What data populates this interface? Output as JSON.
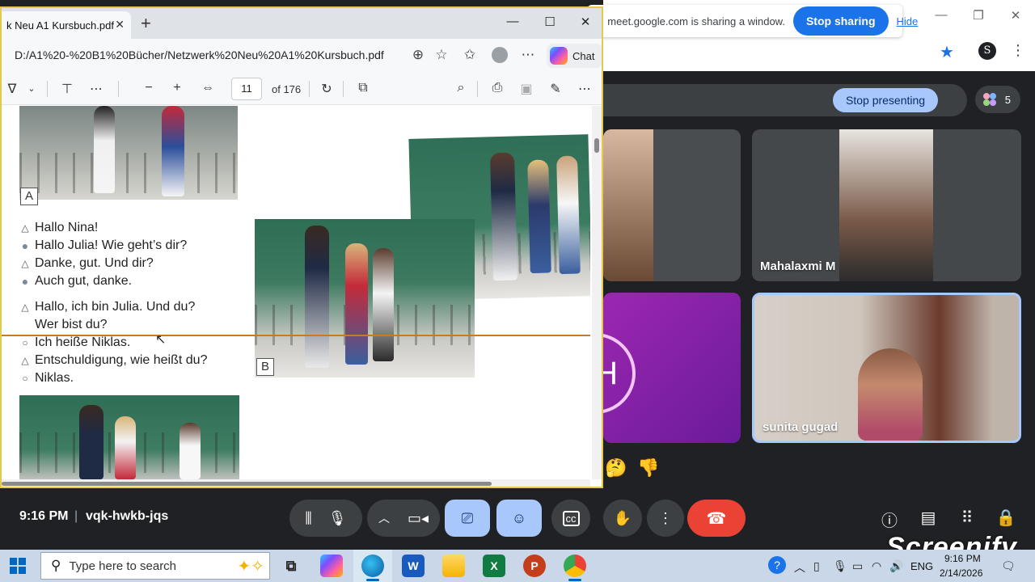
{
  "meet": {
    "share_message": "meet.google.com is sharing a window.",
    "stop_sharing": "Stop sharing",
    "hide": "Hide",
    "stop_presenting": "Stop presenting",
    "participant_count": "5",
    "tiles": [
      {
        "name": ""
      },
      {
        "name": "Mahalaxmi M"
      },
      {
        "name": "",
        "avatar_letter": "H"
      },
      {
        "name": "sunita gugad"
      }
    ],
    "reactions": [
      "🤔",
      "👎"
    ],
    "time": "9:16 PM",
    "separator": "|",
    "meeting_code": "vqk-hwkb-jqs",
    "accent": "#a8c7fa",
    "end_color": "#ea4335"
  },
  "watermark": "Screenify",
  "pdf": {
    "tab_title": "k Neu A1 Kursbuch.pdf",
    "url": "D:/A1%20-%20B1%20Bücher/Netzwerk%20Neu%20A1%20Kursbuch.pdf",
    "chat_label": "Chat",
    "page_current": "11",
    "page_total_label": "of 176",
    "label_a": "A",
    "label_b": "B",
    "dialog": [
      {
        "marker": "△",
        "text": "Hallo Nina!"
      },
      {
        "marker": "●",
        "text": "Hallo Julia! Wie geht’s dir?"
      },
      {
        "marker": "△",
        "text": "Danke, gut. Und dir?"
      },
      {
        "marker": "●",
        "text": "Auch gut, danke."
      },
      {
        "marker": "△",
        "text": "Hallo, ich bin Julia. Und du?"
      },
      {
        "marker": "",
        "text": "Wer bist du?"
      },
      {
        "marker": "○",
        "text": "Ich heiße Niklas."
      },
      {
        "marker": "△",
        "text": "Entschuldigung, wie heißt du?"
      },
      {
        "marker": "○",
        "text": "Niklas."
      }
    ]
  },
  "taskbar": {
    "search_placeholder": "Type here to search",
    "language": "ENG",
    "clock_time": "9:16 PM",
    "clock_date": "2/14/2026",
    "apps": [
      {
        "name": "copilot",
        "label": ""
      },
      {
        "name": "edge",
        "label": ""
      },
      {
        "name": "word",
        "label": "W"
      },
      {
        "name": "explorer",
        "label": ""
      },
      {
        "name": "excel",
        "label": "X"
      },
      {
        "name": "powerpoint",
        "label": "P"
      },
      {
        "name": "chrome",
        "label": ""
      }
    ]
  }
}
